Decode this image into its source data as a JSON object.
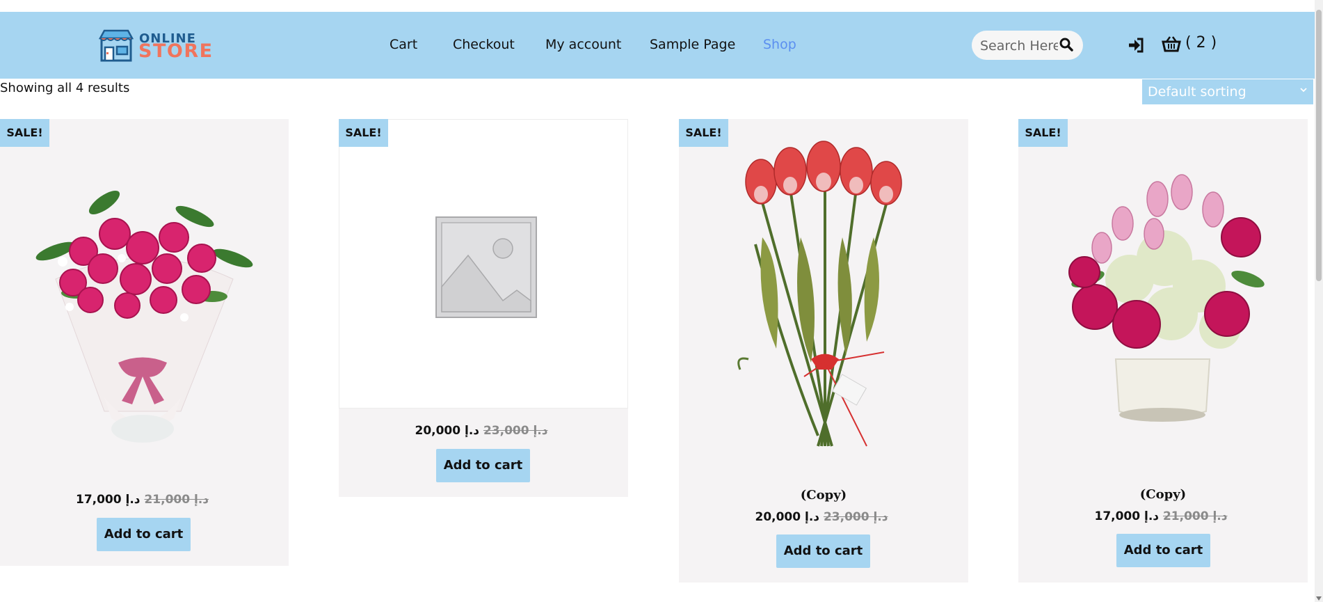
{
  "header": {
    "logo": {
      "line1": "ONLINE",
      "line2": "STORE"
    },
    "nav": [
      {
        "label": "Cart"
      },
      {
        "label": "Checkout"
      },
      {
        "label": "My account"
      },
      {
        "label": "Sample Page"
      },
      {
        "label": "Shop",
        "active": true
      }
    ],
    "search": {
      "placeholder": "Search Here",
      "icon": "search-icon"
    },
    "login_icon": "sign-in-icon",
    "cart": {
      "icon": "basket-icon",
      "count_label": "( 2 )"
    }
  },
  "shop": {
    "result_count": "Showing all 4 results",
    "sorting": {
      "selected": "Default sorting"
    }
  },
  "products": [
    {
      "badge": "SALE!",
      "title": "",
      "old_price": "د.إ 21,000",
      "price": "د.إ 17,000",
      "button": "Add to cart",
      "image": "pink-rose-bouquet"
    },
    {
      "badge": "SALE!",
      "title": "",
      "old_price": "د.إ 23,000",
      "price": "د.إ 20,000",
      "button": "Add to cart",
      "image": "placeholder-image"
    },
    {
      "badge": "SALE!",
      "title": "(Copy)",
      "old_price": "د.إ 23,000",
      "price": "د.إ 20,000",
      "button": "Add to cart",
      "image": "red-tulip-bouquet"
    },
    {
      "badge": "SALE!",
      "title": "(Copy)",
      "old_price": "د.إ 21,000",
      "price": "د.إ 17,000",
      "button": "Add to cart",
      "image": "rose-hydrangea-vase"
    }
  ],
  "colors": {
    "header": "#a6d5f1",
    "active_nav": "#5b8ff0",
    "card_bg": "#f5f3f4",
    "logo_store": "#f0745d",
    "logo_online": "#1f5c8f"
  }
}
